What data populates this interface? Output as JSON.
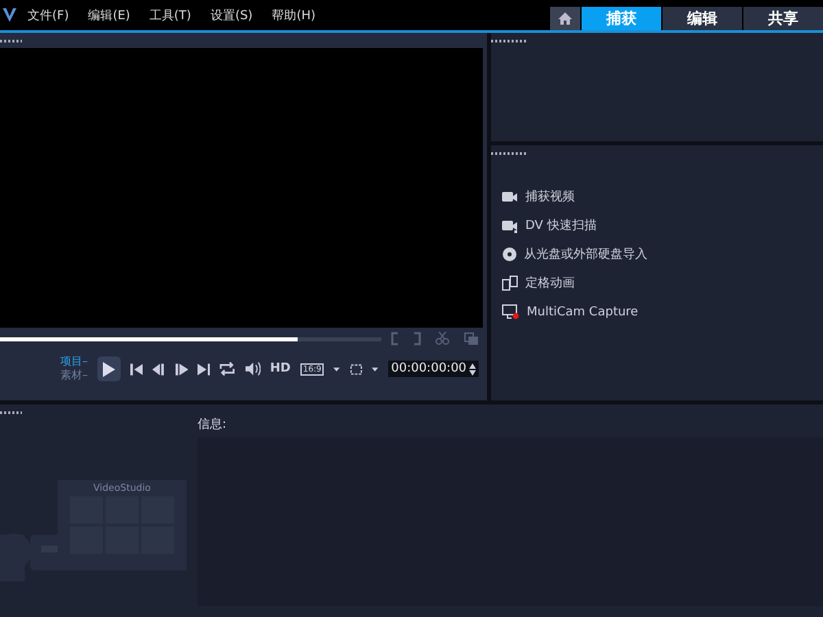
{
  "menu": [
    "文件(F)",
    "编辑(E)",
    "工具(T)",
    "设置(S)",
    "帮助(H)"
  ],
  "tabs": [
    {
      "label": "捕获",
      "selected": true
    },
    {
      "label": "编辑",
      "selected": false
    },
    {
      "label": "共享",
      "selected": false
    }
  ],
  "player": {
    "modes": [
      {
        "label": "项目–",
        "selected": true
      },
      {
        "label": "素材–",
        "selected": false
      }
    ],
    "quality": "HD",
    "aspect": "16:9",
    "timecode": "00:00:00:00",
    "level": 0.78
  },
  "capture_options": [
    {
      "kind": "video",
      "label": "捕获视频"
    },
    {
      "kind": "dv",
      "label": "DV 快速扫描"
    },
    {
      "kind": "disc",
      "label": "从光盘或外部硬盘导入"
    },
    {
      "kind": "stop",
      "label": "定格动画"
    },
    {
      "kind": "multicam",
      "label": "MultiCam Capture"
    }
  ],
  "library": {
    "brand": "VideoStudio"
  },
  "info": {
    "label": "信息:"
  }
}
